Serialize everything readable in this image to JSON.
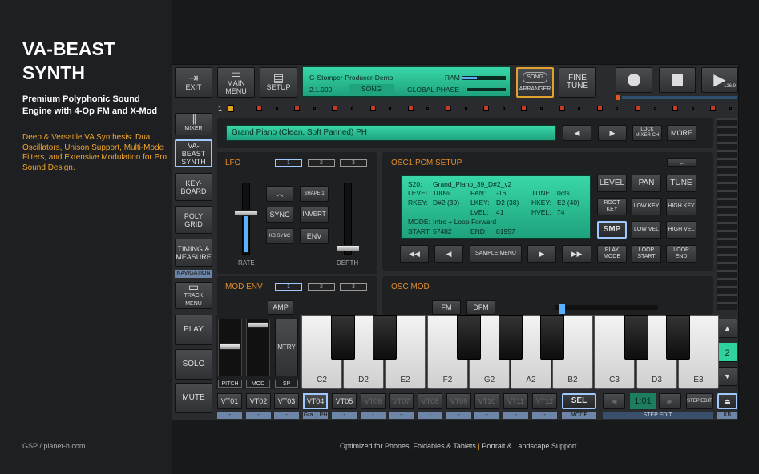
{
  "promo": {
    "title": "VA-BEAST SYNTH",
    "subtitle": "Premium Polyphonic Sound Engine with 4-Op FM and X-Mod",
    "description": "Deep & Versatile VA Synthesis. Dual Oscillators, Unison Support, Multi-Mode Filters, and Extensive Modulation for Pro Sound Design.",
    "credit": "GSP / planet-h.com",
    "footer_left": "Optimized for Phones, Foldables & Tablets",
    "footer_sep": "|",
    "footer_right": "Portrait & Landscape Support"
  },
  "toolbar": {
    "exit": "EXIT",
    "main_menu": "MAIN MENU",
    "setup": "SETUP",
    "song_name": "G-Stomper-Producer-Demo",
    "ram_label": "RAM",
    "version": "2.1.000",
    "song_mode": "SONG",
    "global_phase": "GLOBAL PHASE",
    "arranger_badge": "SONG",
    "arranger": "ARRANGER",
    "fine_tune": "FINE TUNE",
    "tempo": "126.9"
  },
  "accent_color": "#2fd3a0",
  "step_row": {
    "index": "1"
  },
  "nav": {
    "mixer": "MIXER",
    "va_beast": "VA-BEAST SYNTH",
    "keyboard": "KEY-BOARD",
    "poly_grid": "POLY GRID",
    "timing": "TIMING & MEASURE",
    "navigation": "NAVIGATION",
    "track_menu": "TRACK MENU",
    "play": "PLAY",
    "solo": "SOLO",
    "mute": "MUTE"
  },
  "preset": {
    "name": "Grand Piano (Clean, Soft Panned) PH",
    "lock": "LOCK MIXER-CH",
    "more": "MORE"
  },
  "lfo": {
    "title": "LFO",
    "tabs": [
      "1",
      "2",
      "3"
    ],
    "rate": "RATE",
    "depth": "DEPTH",
    "shape": "SHAPE 1",
    "sync": "SYNC",
    "invert": "INVERT",
    "kb_sync": "KB SYNC",
    "env": "ENV"
  },
  "mod_env": {
    "title": "MOD ENV",
    "tabs": [
      "1",
      "2",
      "3"
    ],
    "amp": "AMP"
  },
  "osc1": {
    "title": "OSC1 PCM SETUP",
    "lcd": {
      "line1_label": "S20:",
      "line1_value": "Grand_Piano_39_D#2_v2",
      "level_label": "LEVEL:",
      "level": "100%",
      "pan_label": "PAN:",
      "pan": "-16",
      "tune_label": "TUNE:",
      "tune": "0cts",
      "rkey_label": "RKEY:",
      "rkey": "D#2 (39)",
      "lkey_label": "LKEY:",
      "lkey": "D2 (38)",
      "hkey_label": "HKEY:",
      "hkey": "E2 (40)",
      "lvel_label": "LVEL:",
      "lvel": "41",
      "hvel_label": "HVEL:",
      "hvel": "74",
      "mode_label": "MODE:",
      "mode": "Intro + Loop Forward",
      "start_label": "START:",
      "start": "57482",
      "end_label": "END:",
      "end": "81957"
    },
    "buttons": {
      "level": "LEVEL",
      "pan": "PAN",
      "tune": "TUNE",
      "root_key": "ROOT KEY",
      "low_key": "LOW KEY",
      "high_key": "HIGH KEY",
      "smp": "SMP",
      "low_vel": "LOW VEL",
      "high_vel": "HIGH VEL",
      "play_mode": "PLAY MODE",
      "loop_start": "LOOP START",
      "loop_end": "LOOP END",
      "sample_menu": "SAMPLE MENU"
    }
  },
  "osc_mod": {
    "title": "OSC MOD",
    "fm": "FM",
    "dfm": "DFM"
  },
  "mixer_strip": {
    "mtry": "MTRY",
    "pitch": "PITCH",
    "mod": "MOD",
    "sp": "SP"
  },
  "keyboard": {
    "keys": [
      "C2",
      "D2",
      "E2",
      "F2",
      "G2",
      "A2",
      "B2",
      "C3",
      "D3",
      "E3"
    ],
    "octave": "2"
  },
  "tracks": {
    "labels": [
      "VT01",
      "VT02",
      "VT03",
      "VT04",
      "VT05",
      "VT06",
      "VT07",
      "VT08",
      "VT09",
      "VT10",
      "VT11",
      "VT12"
    ],
    "sublabels": [
      "-",
      "-",
      "-",
      "Gra..) PH",
      "-",
      "-",
      "-",
      "-",
      "-",
      "-",
      "-",
      "-"
    ],
    "sel": "SEL",
    "mode": "MODE",
    "step": "1:01",
    "step_edit_btn": "STEP EDIT",
    "step_edit": "STEP EDIT",
    "kb": "KB"
  }
}
